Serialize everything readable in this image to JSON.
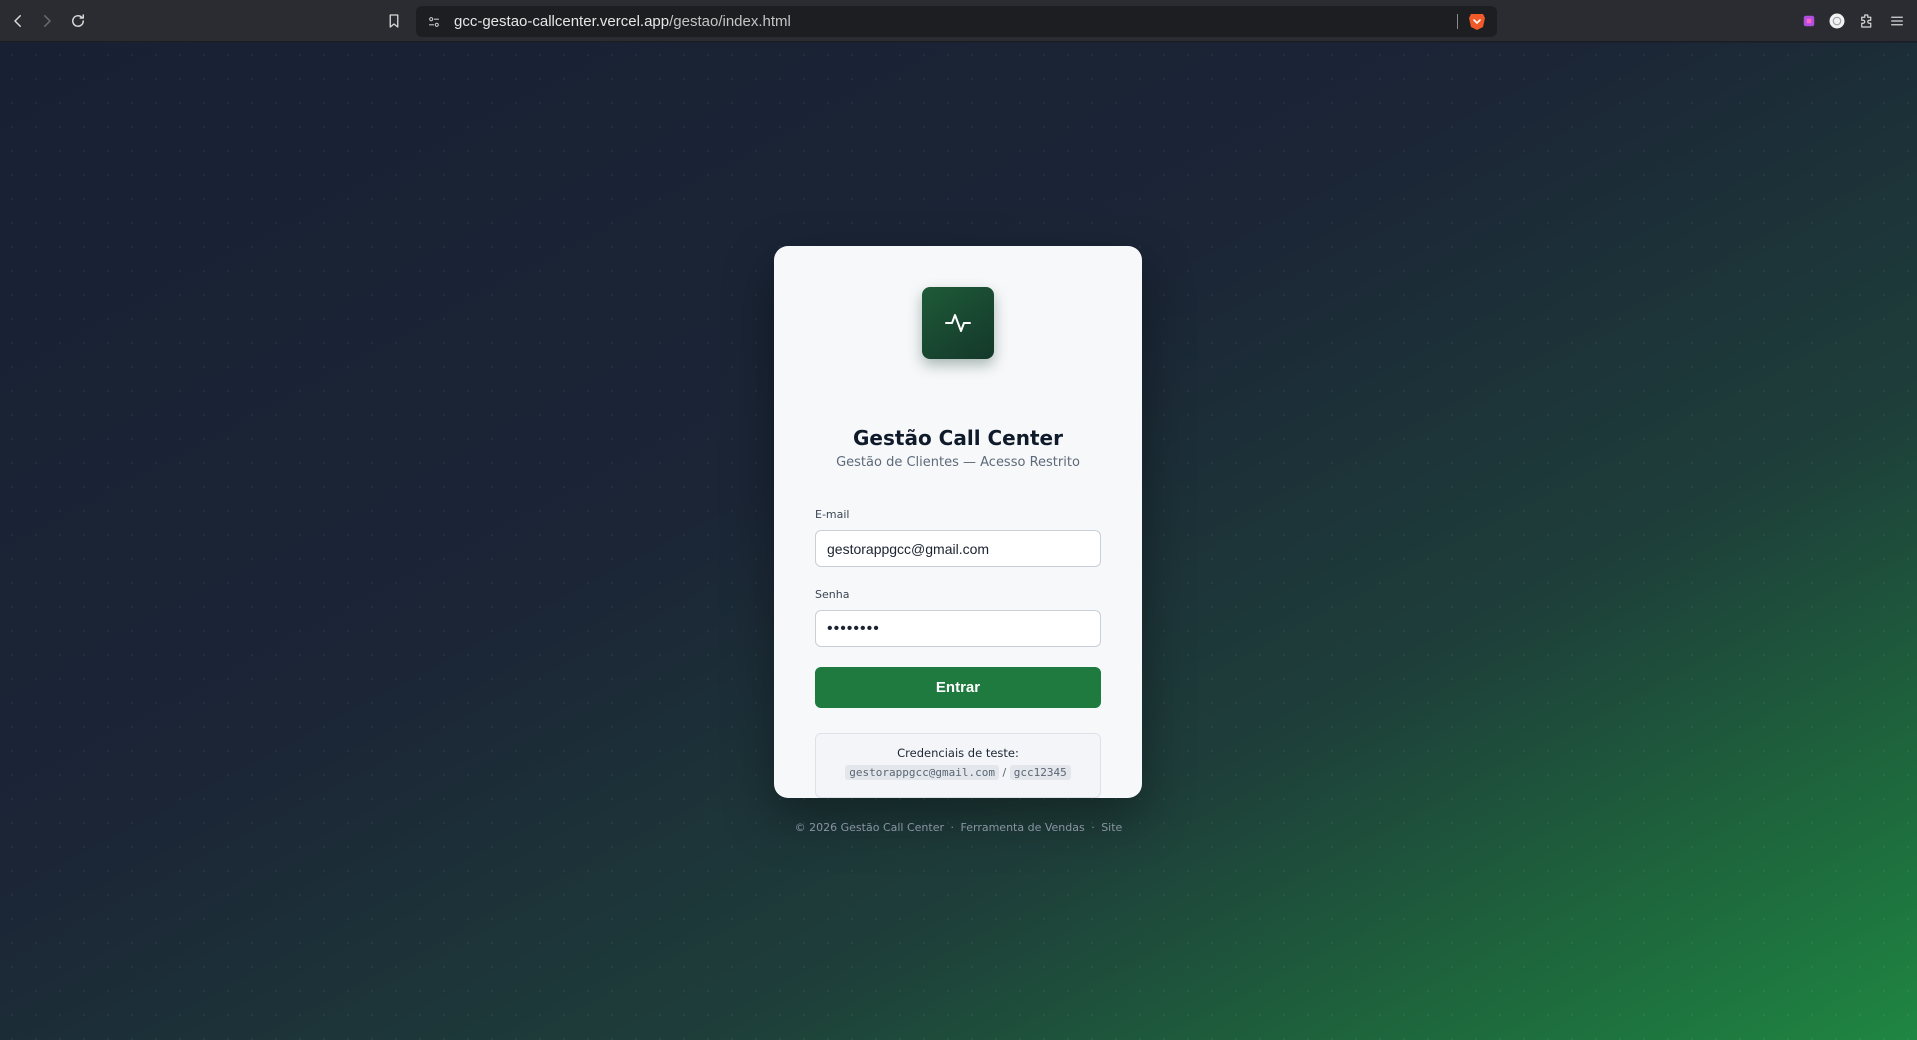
{
  "browser": {
    "url_host": "gcc-gestao-callcenter.vercel.app",
    "url_path": "/gestao/index.html"
  },
  "login": {
    "logo_icon": "activity-pulse-icon",
    "title": "Gestão Call Center",
    "subtitle": "Gestão de Clientes — Acesso Restrito",
    "email_label": "E-mail",
    "email_value": "gestorappgcc@gmail.com",
    "password_label": "Senha",
    "password_value": "••••••••",
    "submit_label": "Entrar",
    "credentials": {
      "title": "Credenciais de teste:",
      "email": "gestorappgcc@gmail.com",
      "separator": "/",
      "password": "gcc12345"
    }
  },
  "footer": {
    "copyright": "© 2026 Gestão Call Center",
    "sep1": "·",
    "link1": "Ferramenta de Vendas",
    "sep2": "·",
    "link2": "Site"
  },
  "colors": {
    "accent": "#1e7a3f",
    "logo_bg": "#1a4a30"
  }
}
